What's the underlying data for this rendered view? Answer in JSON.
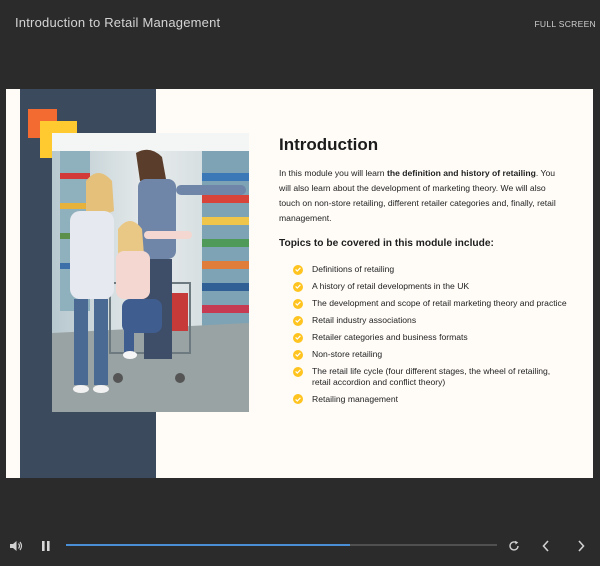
{
  "header": {
    "course_title": "Introduction to Retail Management",
    "fullscreen_label": "FULL SCREEN"
  },
  "slide": {
    "heading": "Introduction",
    "intro": {
      "part1": "In this module you will learn ",
      "bold": "the definition and history of retailing",
      "part2": ". You will also learn about the development of marketing theory. We will also touch on non-store retailing, different retailer categories and, finally, retail management."
    },
    "topics_heading": "Topics to be covered in this module include:",
    "topics": [
      "Definitions of retailing",
      "A history of retail developments in the UK",
      "The development and scope of retail marketing theory and practice",
      "Retail industry associations",
      "Retailer categories and business formats",
      "Non-store retailing",
      "The retail life cycle (four different stages, the wheel of retailing, retail accordion and conflict theory)",
      "Retailing management"
    ],
    "colors": {
      "navy": "#3c4a5e",
      "orange": "#f36b31",
      "yellow": "#ffc930",
      "bullet": "#ffc41f"
    },
    "photo_icon": "family-shopping-photo"
  },
  "player": {
    "progress": 0.66,
    "accent": "#4a8fd6",
    "icons": [
      "volume-icon",
      "pause-icon",
      "replay-icon",
      "previous-icon",
      "next-icon"
    ]
  }
}
